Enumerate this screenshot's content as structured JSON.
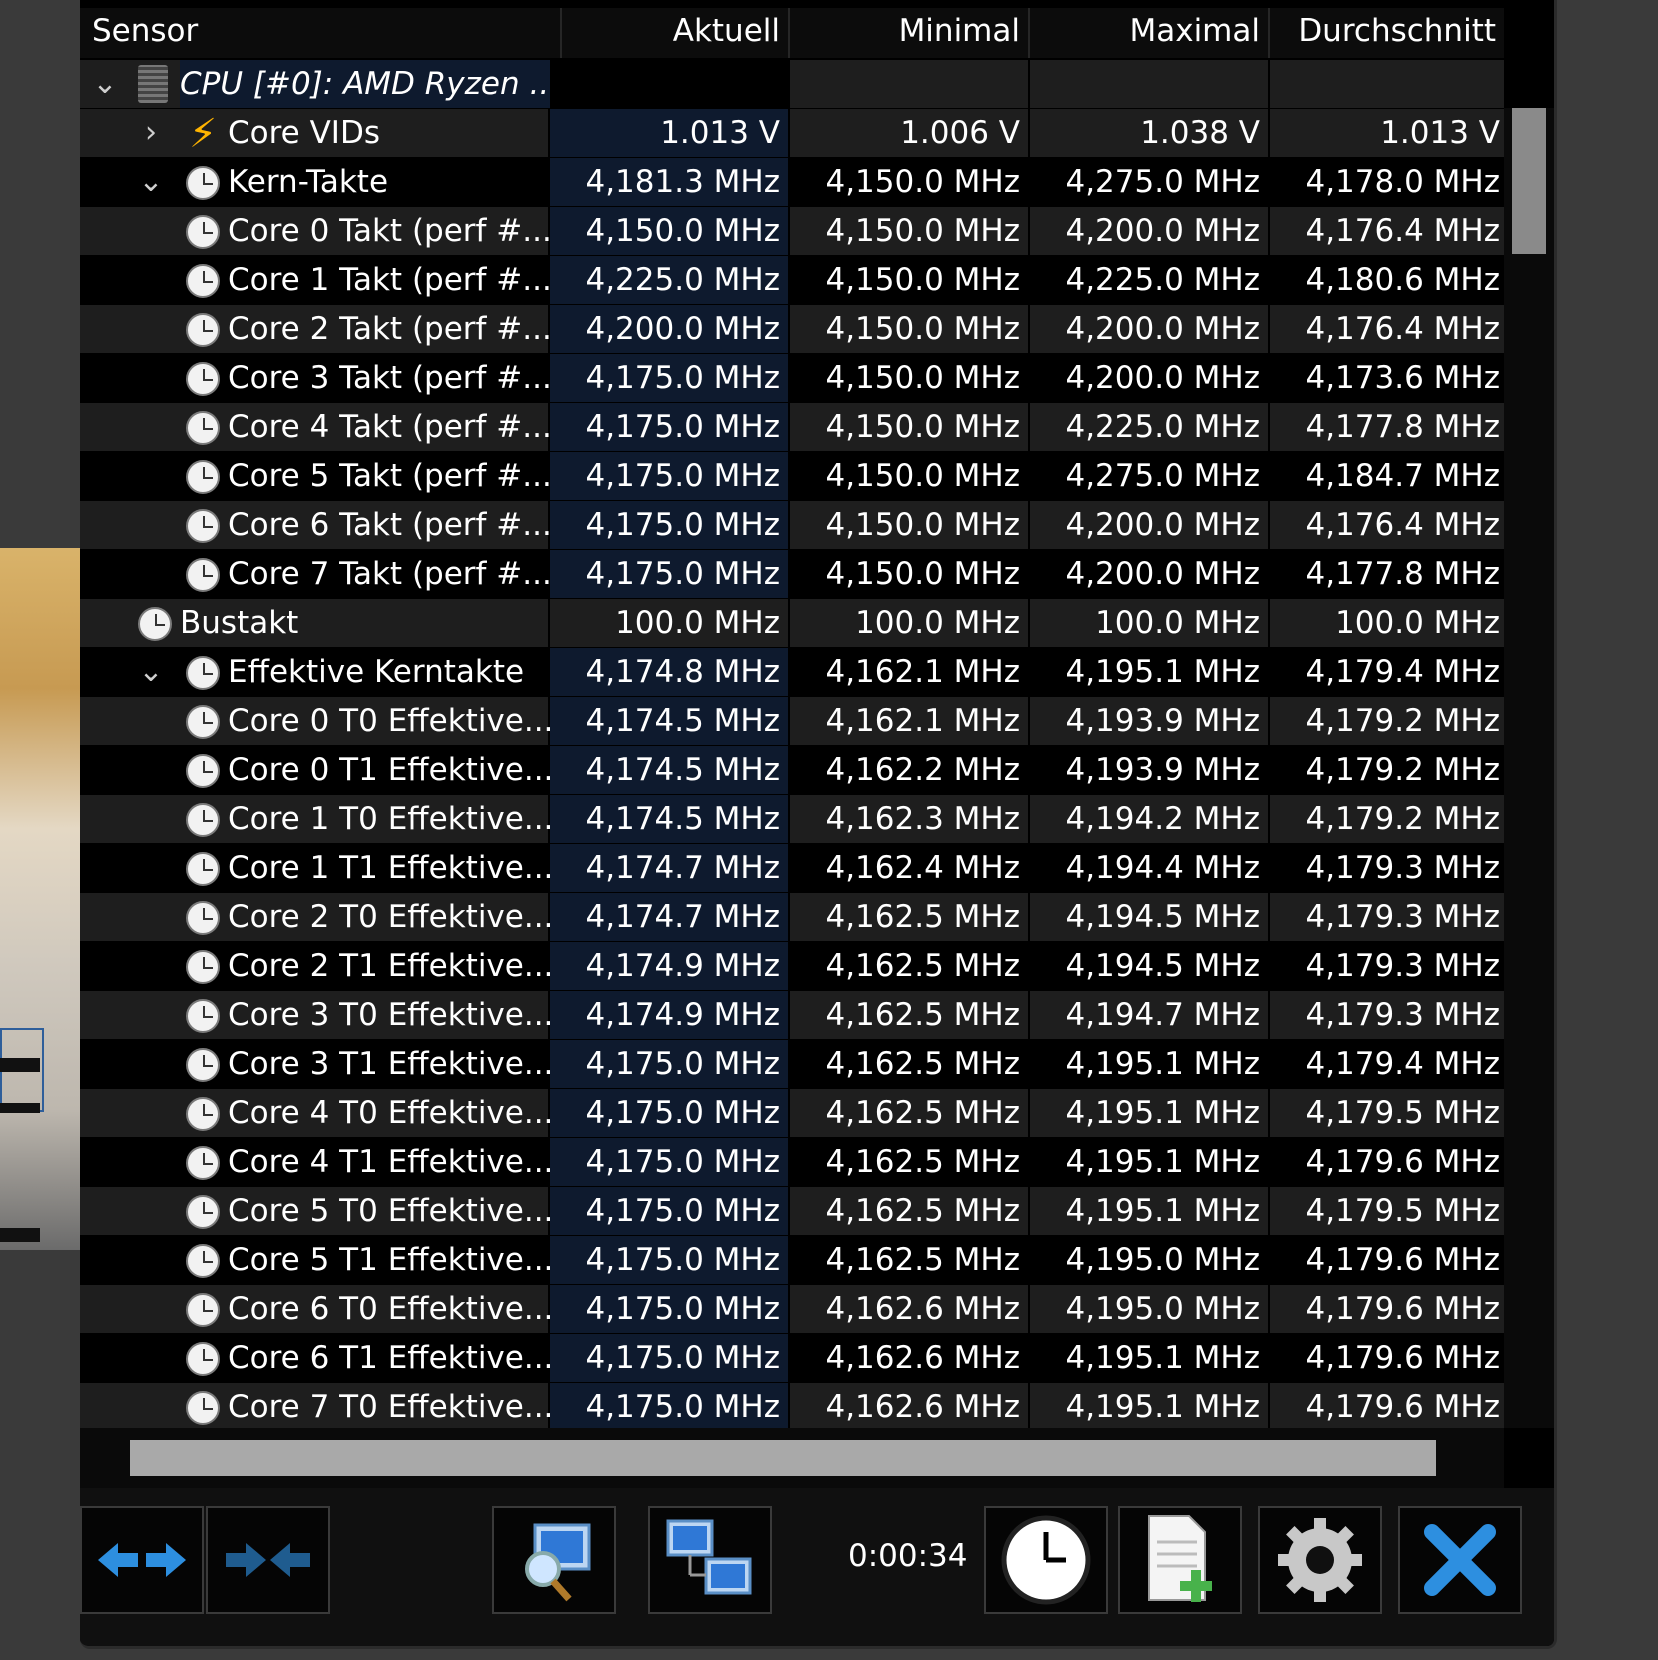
{
  "columns": {
    "sensor": "Sensor",
    "current": "Aktuell",
    "min": "Minimal",
    "max": "Maximal",
    "avg": "Durchschnitt"
  },
  "rows": [
    {
      "kind": "group",
      "level": 0,
      "expander": "expanded",
      "icon": "chip-icon",
      "label": "CPU [#0]: AMD Ryzen ...",
      "cur": "",
      "min": "",
      "max": "",
      "avg": ""
    },
    {
      "kind": "item",
      "level": 1,
      "expander": "collapsed",
      "icon": "lightning-icon",
      "label": "Core VIDs",
      "cur": "1.013 V",
      "min": "1.006 V",
      "max": "1.038 V",
      "avg": "1.013 V"
    },
    {
      "kind": "item",
      "level": 1,
      "expander": "expanded",
      "icon": "clock-icon",
      "label": "Kern-Takte",
      "cur": "4,181.3 MHz",
      "min": "4,150.0 MHz",
      "max": "4,275.0 MHz",
      "avg": "4,178.0 MHz"
    },
    {
      "kind": "item",
      "level": 2,
      "expander": "",
      "icon": "clock-icon",
      "label": "Core 0 Takt (perf #...",
      "cur": "4,150.0 MHz",
      "min": "4,150.0 MHz",
      "max": "4,200.0 MHz",
      "avg": "4,176.4 MHz"
    },
    {
      "kind": "item",
      "level": 2,
      "expander": "",
      "icon": "clock-icon",
      "label": "Core 1 Takt (perf #...",
      "cur": "4,225.0 MHz",
      "min": "4,150.0 MHz",
      "max": "4,225.0 MHz",
      "avg": "4,180.6 MHz"
    },
    {
      "kind": "item",
      "level": 2,
      "expander": "",
      "icon": "clock-icon",
      "label": "Core 2 Takt (perf #...",
      "cur": "4,200.0 MHz",
      "min": "4,150.0 MHz",
      "max": "4,200.0 MHz",
      "avg": "4,176.4 MHz"
    },
    {
      "kind": "item",
      "level": 2,
      "expander": "",
      "icon": "clock-icon",
      "label": "Core 3 Takt (perf #...",
      "cur": "4,175.0 MHz",
      "min": "4,150.0 MHz",
      "max": "4,200.0 MHz",
      "avg": "4,173.6 MHz"
    },
    {
      "kind": "item",
      "level": 2,
      "expander": "",
      "icon": "clock-icon",
      "label": "Core 4 Takt (perf #...",
      "cur": "4,175.0 MHz",
      "min": "4,150.0 MHz",
      "max": "4,225.0 MHz",
      "avg": "4,177.8 MHz"
    },
    {
      "kind": "item",
      "level": 2,
      "expander": "",
      "icon": "clock-icon",
      "label": "Core 5 Takt (perf #...",
      "cur": "4,175.0 MHz",
      "min": "4,150.0 MHz",
      "max": "4,275.0 MHz",
      "avg": "4,184.7 MHz"
    },
    {
      "kind": "item",
      "level": 2,
      "expander": "",
      "icon": "clock-icon",
      "label": "Core 6 Takt (perf #...",
      "cur": "4,175.0 MHz",
      "min": "4,150.0 MHz",
      "max": "4,200.0 MHz",
      "avg": "4,176.4 MHz"
    },
    {
      "kind": "item",
      "level": 2,
      "expander": "",
      "icon": "clock-icon",
      "label": "Core 7 Takt (perf #...",
      "cur": "4,175.0 MHz",
      "min": "4,150.0 MHz",
      "max": "4,200.0 MHz",
      "avg": "4,177.8 MHz"
    },
    {
      "kind": "bus",
      "level": 0.5,
      "expander": "",
      "icon": "clock-icon",
      "label": "Bustakt",
      "cur": "100.0 MHz",
      "min": "100.0 MHz",
      "max": "100.0 MHz",
      "avg": "100.0 MHz"
    },
    {
      "kind": "item",
      "level": 1,
      "expander": "expanded",
      "icon": "clock-icon",
      "label": "Effektive Kerntakte",
      "cur": "4,174.8 MHz",
      "min": "4,162.1 MHz",
      "max": "4,195.1 MHz",
      "avg": "4,179.4 MHz"
    },
    {
      "kind": "item",
      "level": 2,
      "expander": "",
      "icon": "clock-icon",
      "label": "Core 0 T0 Effektive...",
      "cur": "4,174.5 MHz",
      "min": "4,162.1 MHz",
      "max": "4,193.9 MHz",
      "avg": "4,179.2 MHz"
    },
    {
      "kind": "item",
      "level": 2,
      "expander": "",
      "icon": "clock-icon",
      "label": "Core 0 T1 Effektive...",
      "cur": "4,174.5 MHz",
      "min": "4,162.2 MHz",
      "max": "4,193.9 MHz",
      "avg": "4,179.2 MHz"
    },
    {
      "kind": "item",
      "level": 2,
      "expander": "",
      "icon": "clock-icon",
      "label": "Core 1 T0 Effektive...",
      "cur": "4,174.5 MHz",
      "min": "4,162.3 MHz",
      "max": "4,194.2 MHz",
      "avg": "4,179.2 MHz"
    },
    {
      "kind": "item",
      "level": 2,
      "expander": "",
      "icon": "clock-icon",
      "label": "Core 1 T1 Effektive...",
      "cur": "4,174.7 MHz",
      "min": "4,162.4 MHz",
      "max": "4,194.4 MHz",
      "avg": "4,179.3 MHz"
    },
    {
      "kind": "item",
      "level": 2,
      "expander": "",
      "icon": "clock-icon",
      "label": "Core 2 T0 Effektive...",
      "cur": "4,174.7 MHz",
      "min": "4,162.5 MHz",
      "max": "4,194.5 MHz",
      "avg": "4,179.3 MHz"
    },
    {
      "kind": "item",
      "level": 2,
      "expander": "",
      "icon": "clock-icon",
      "label": "Core 2 T1 Effektive...",
      "cur": "4,174.9 MHz",
      "min": "4,162.5 MHz",
      "max": "4,194.5 MHz",
      "avg": "4,179.3 MHz"
    },
    {
      "kind": "item",
      "level": 2,
      "expander": "",
      "icon": "clock-icon",
      "label": "Core 3 T0 Effektive...",
      "cur": "4,174.9 MHz",
      "min": "4,162.5 MHz",
      "max": "4,194.7 MHz",
      "avg": "4,179.3 MHz"
    },
    {
      "kind": "item",
      "level": 2,
      "expander": "",
      "icon": "clock-icon",
      "label": "Core 3 T1 Effektive...",
      "cur": "4,175.0 MHz",
      "min": "4,162.5 MHz",
      "max": "4,195.1 MHz",
      "avg": "4,179.4 MHz"
    },
    {
      "kind": "item",
      "level": 2,
      "expander": "",
      "icon": "clock-icon",
      "label": "Core 4 T0 Effektive...",
      "cur": "4,175.0 MHz",
      "min": "4,162.5 MHz",
      "max": "4,195.1 MHz",
      "avg": "4,179.5 MHz"
    },
    {
      "kind": "item",
      "level": 2,
      "expander": "",
      "icon": "clock-icon",
      "label": "Core 4 T1 Effektive...",
      "cur": "4,175.0 MHz",
      "min": "4,162.5 MHz",
      "max": "4,195.1 MHz",
      "avg": "4,179.6 MHz"
    },
    {
      "kind": "item",
      "level": 2,
      "expander": "",
      "icon": "clock-icon",
      "label": "Core 5 T0 Effektive...",
      "cur": "4,175.0 MHz",
      "min": "4,162.5 MHz",
      "max": "4,195.1 MHz",
      "avg": "4,179.5 MHz"
    },
    {
      "kind": "item",
      "level": 2,
      "expander": "",
      "icon": "clock-icon",
      "label": "Core 5 T1 Effektive...",
      "cur": "4,175.0 MHz",
      "min": "4,162.5 MHz",
      "max": "4,195.0 MHz",
      "avg": "4,179.6 MHz"
    },
    {
      "kind": "item",
      "level": 2,
      "expander": "",
      "icon": "clock-icon",
      "label": "Core 6 T0 Effektive...",
      "cur": "4,175.0 MHz",
      "min": "4,162.6 MHz",
      "max": "4,195.0 MHz",
      "avg": "4,179.6 MHz"
    },
    {
      "kind": "item",
      "level": 2,
      "expander": "",
      "icon": "clock-icon",
      "label": "Core 6 T1 Effektive...",
      "cur": "4,175.0 MHz",
      "min": "4,162.6 MHz",
      "max": "4,195.1 MHz",
      "avg": "4,179.6 MHz"
    },
    {
      "kind": "item",
      "level": 2,
      "expander": "",
      "icon": "clock-icon",
      "label": "Core 7 T0 Effektive...",
      "cur": "4,175.0 MHz",
      "min": "4,162.6 MHz",
      "max": "4,195.1 MHz",
      "avg": "4,179.6 MHz"
    }
  ],
  "toolbar": {
    "timer": "0:00:34",
    "buttons": [
      {
        "name": "expand-columns-button",
        "icon": "arrows-out-icon"
      },
      {
        "name": "collapse-columns-button",
        "icon": "arrows-in-icon"
      },
      {
        "name": "sensor-status-button",
        "icon": "monitor-magnifier-icon"
      },
      {
        "name": "network-button",
        "icon": "network-monitors-icon"
      },
      {
        "name": "reset-clock-button",
        "icon": "clock-icon"
      },
      {
        "name": "logging-button",
        "icon": "add-document-icon"
      },
      {
        "name": "settings-button",
        "icon": "gear-icon"
      },
      {
        "name": "close-button",
        "icon": "close-icon"
      }
    ]
  },
  "colors": {
    "background": "#000000",
    "row_alt": "#1e1e1e",
    "current_column": "#0e1a2e",
    "accent_blue": "#1e90ff"
  }
}
